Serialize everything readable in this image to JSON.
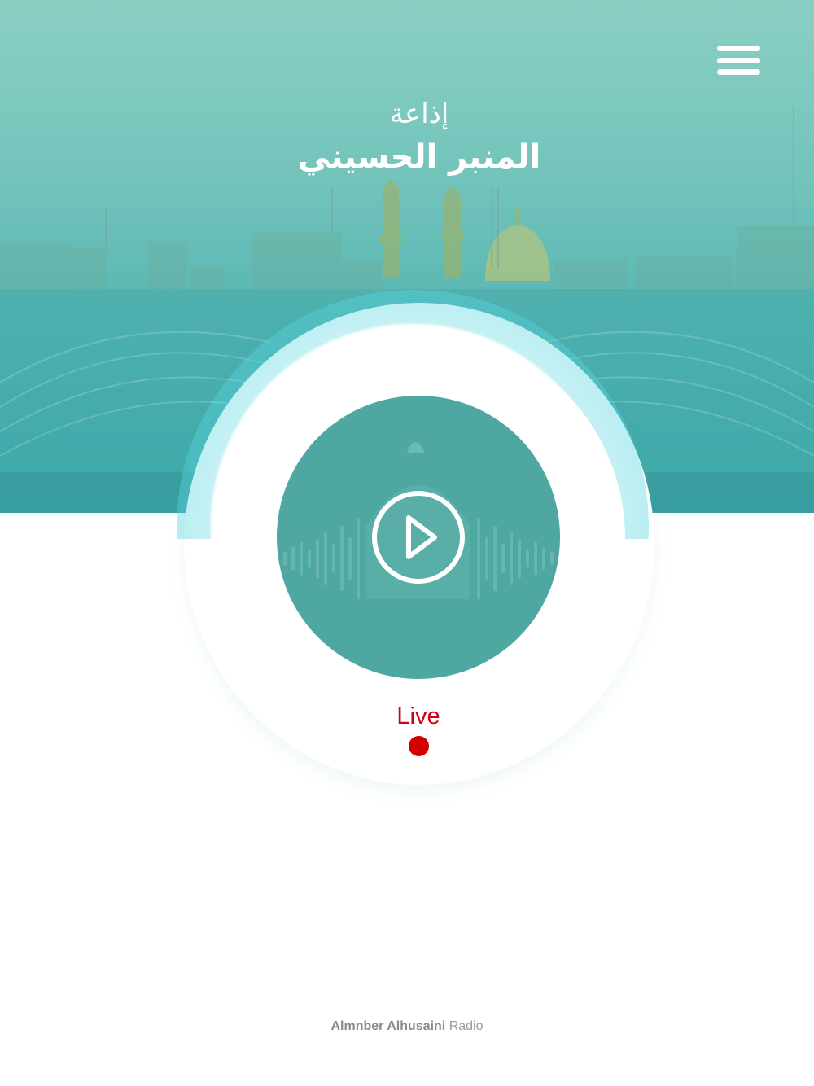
{
  "header": {
    "title_line1": "إذاعة",
    "title_line2": "المنبر الحسيني",
    "menu_icon": "hamburger-menu-icon"
  },
  "player": {
    "play_icon": "play-circle-icon",
    "status_label": "Live",
    "status_indicator_color": "#d40000",
    "accent_color": "#4ea7a0"
  },
  "footer": {
    "brand": "Almnber Alhusaini",
    "suffix": "Radio"
  }
}
